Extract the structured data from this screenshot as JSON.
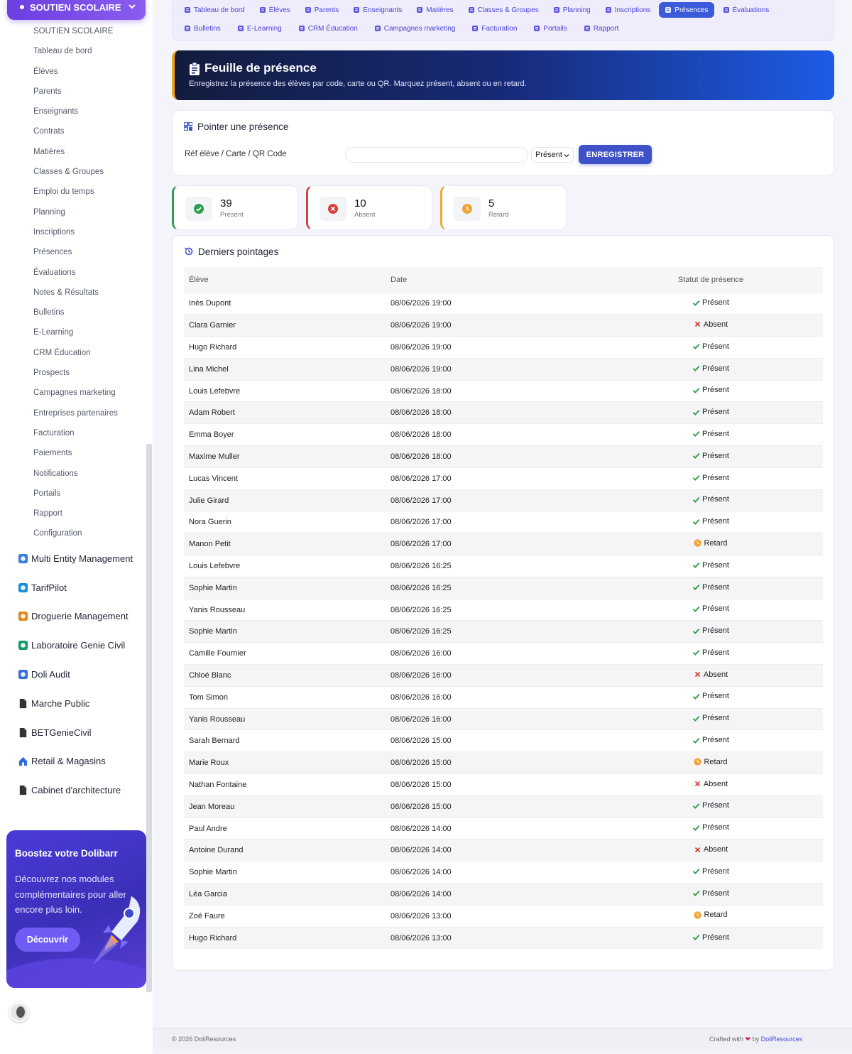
{
  "sidebar": {
    "module_title": "SOUTIEN SCOLAIRE",
    "sub_items": [
      "SOUTIEN SCOLAIRE",
      "Tableau de bord",
      "Élèves",
      "Parents",
      "Enseignants",
      "Contrats",
      "Matières",
      "Classes & Groupes",
      "Emploi du temps",
      "Planning",
      "Inscriptions",
      "Présences",
      "Évaluations",
      "Notes & Résultats",
      "Bulletins",
      "E-Learning",
      "CRM Éducation",
      "Prospects",
      "Campagnes marketing",
      "Entreprises partenaires",
      "Facturation",
      "Paiements",
      "Notifications",
      "Portails",
      "Rapport",
      "Configuration"
    ],
    "modules": [
      {
        "label": "Multi Entity Management",
        "icon": "multi-entity-icon",
        "color": "#3b7dd8"
      },
      {
        "label": "TarifPilot",
        "icon": "tarifpilot-icon",
        "color": "#1d8fd8"
      },
      {
        "label": "Droguerie Management",
        "icon": "droguerie-icon",
        "color": "#e08a1d"
      },
      {
        "label": "Laboratoire Genie Civil",
        "icon": "laboratoire-icon",
        "color": "#1a9a6b"
      },
      {
        "label": "Doli Audit",
        "icon": "audit-icon",
        "color": "#3b6ed8"
      },
      {
        "label": "Marche Public",
        "icon": "document-icon",
        "color": "#333333"
      },
      {
        "label": "BETGenieCivil",
        "icon": "document-icon",
        "color": "#333333"
      },
      {
        "label": "Retail & Magasins",
        "icon": "home-icon",
        "color": "#2f6be0"
      },
      {
        "label": "Cabinet d'architecture",
        "icon": "document-icon",
        "color": "#333333"
      }
    ],
    "promo": {
      "title": "Boostez votre Dolibarr",
      "text": "Découvrez nos modules complémentaires pour aller encore plus loin.",
      "button": "Découvrir"
    }
  },
  "topnav": {
    "row1": [
      {
        "label": "Tableau de bord",
        "icon": "dashboard-icon"
      },
      {
        "label": "Élèves",
        "icon": "students-icon"
      },
      {
        "label": "Parents",
        "icon": "parents-icon"
      },
      {
        "label": "Enseignants",
        "icon": "teachers-icon"
      },
      {
        "label": "Matières",
        "icon": "book-icon"
      },
      {
        "label": "Classes & Groupes",
        "icon": "layers-icon"
      },
      {
        "label": "Planning",
        "icon": "calendar-icon"
      },
      {
        "label": "Inscriptions",
        "icon": "clipboard-check-icon"
      },
      {
        "label": "Présences",
        "icon": "clipboard-icon",
        "active": true
      },
      {
        "label": "Évaluations",
        "icon": "pencil-icon"
      }
    ],
    "row2": [
      {
        "label": "Bulletins",
        "icon": "bulletin-icon"
      },
      {
        "label": "E-Learning",
        "icon": "video-icon"
      },
      {
        "label": "CRM Éducation",
        "icon": "list-icon"
      },
      {
        "label": "Campagnes marketing",
        "icon": "megaphone-icon"
      },
      {
        "label": "Facturation",
        "icon": "invoice-icon"
      },
      {
        "label": "Portails",
        "icon": "user-circle-icon"
      },
      {
        "label": "Rapport",
        "icon": "pie-chart-icon"
      }
    ]
  },
  "banner": {
    "title": "Feuille de présence",
    "subtitle": "Enregistrez la présence des élèves par code, carte ou QR. Marquez présent, absent ou en retard."
  },
  "pointer": {
    "title": "Pointer une présence",
    "field_label": "Réf élève / Carte / QR Code",
    "input_value": "",
    "input_placeholder": "",
    "status_selected": "Présent",
    "save_button": "ENREGISTRER"
  },
  "stats": [
    {
      "value": "39",
      "label": "Présent",
      "color": "#2e9e4f"
    },
    {
      "value": "10",
      "label": "Absent",
      "color": "#d9413a"
    },
    {
      "value": "5",
      "label": "Retard",
      "color": "#f0a53a"
    }
  ],
  "recent": {
    "title": "Derniers pointages",
    "columns": [
      "Élève",
      "Date",
      "Statut de présence"
    ],
    "rows": [
      {
        "student": "Inès Dupont",
        "date": "08/06/2026 19:00",
        "status": "Présent"
      },
      {
        "student": "Clara Garnier",
        "date": "08/06/2026 19:00",
        "status": "Absent"
      },
      {
        "student": "Hugo Richard",
        "date": "08/06/2026 19:00",
        "status": "Présent"
      },
      {
        "student": "Lina Michel",
        "date": "08/06/2026 19:00",
        "status": "Présent"
      },
      {
        "student": "Louis Lefebvre",
        "date": "08/06/2026 18:00",
        "status": "Présent"
      },
      {
        "student": "Adam Robert",
        "date": "08/06/2026 18:00",
        "status": "Présent"
      },
      {
        "student": "Emma Boyer",
        "date": "08/06/2026 18:00",
        "status": "Présent"
      },
      {
        "student": "Maxime Muller",
        "date": "08/06/2026 18:00",
        "status": "Présent"
      },
      {
        "student": "Lucas Vincent",
        "date": "08/06/2026 17:00",
        "status": "Présent"
      },
      {
        "student": "Julie Girard",
        "date": "08/06/2026 17:00",
        "status": "Présent"
      },
      {
        "student": "Nora Guerin",
        "date": "08/06/2026 17:00",
        "status": "Présent"
      },
      {
        "student": "Manon Petit",
        "date": "08/06/2026 17:00",
        "status": "Retard"
      },
      {
        "student": "Louis Lefebvre",
        "date": "08/06/2026 16:25",
        "status": "Présent"
      },
      {
        "student": "Sophie Martin",
        "date": "08/06/2026 16:25",
        "status": "Présent"
      },
      {
        "student": "Yanis Rousseau",
        "date": "08/06/2026 16:25",
        "status": "Présent"
      },
      {
        "student": "Sophie Martin",
        "date": "08/06/2026 16:25",
        "status": "Présent"
      },
      {
        "student": "Camille Fournier",
        "date": "08/06/2026 16:00",
        "status": "Présent"
      },
      {
        "student": "Chloé Blanc",
        "date": "08/06/2026 16:00",
        "status": "Absent"
      },
      {
        "student": "Tom Simon",
        "date": "08/06/2026 16:00",
        "status": "Présent"
      },
      {
        "student": "Yanis Rousseau",
        "date": "08/06/2026 16:00",
        "status": "Présent"
      },
      {
        "student": "Sarah Bernard",
        "date": "08/06/2026 15:00",
        "status": "Présent"
      },
      {
        "student": "Marie Roux",
        "date": "08/06/2026 15:00",
        "status": "Retard"
      },
      {
        "student": "Nathan Fontaine",
        "date": "08/06/2026 15:00",
        "status": "Absent"
      },
      {
        "student": "Jean Moreau",
        "date": "08/06/2026 15:00",
        "status": "Présent"
      },
      {
        "student": "Paul Andre",
        "date": "08/06/2026 14:00",
        "status": "Présent"
      },
      {
        "student": "Antoine Durand",
        "date": "08/06/2026 14:00",
        "status": "Absent"
      },
      {
        "student": "Sophie Martin",
        "date": "08/06/2026 14:00",
        "status": "Présent"
      },
      {
        "student": "Léa Garcia",
        "date": "08/06/2026 14:00",
        "status": "Présent"
      },
      {
        "student": "Zoé Faure",
        "date": "08/06/2026 13:00",
        "status": "Retard"
      },
      {
        "student": "Hugo Richard",
        "date": "08/06/2026 13:00",
        "status": "Présent"
      }
    ]
  },
  "footer": {
    "copyright": "© 2026 DoliResources",
    "crafted_prefix": "Crafted with",
    "crafted_by": "by",
    "crafted_link": "DoliResources"
  },
  "colors": {
    "accent": "#4b42d8",
    "active_tab": "#3b5bdb",
    "present": "#2e9e4f",
    "absent": "#d9413a",
    "late": "#f0a53a"
  }
}
